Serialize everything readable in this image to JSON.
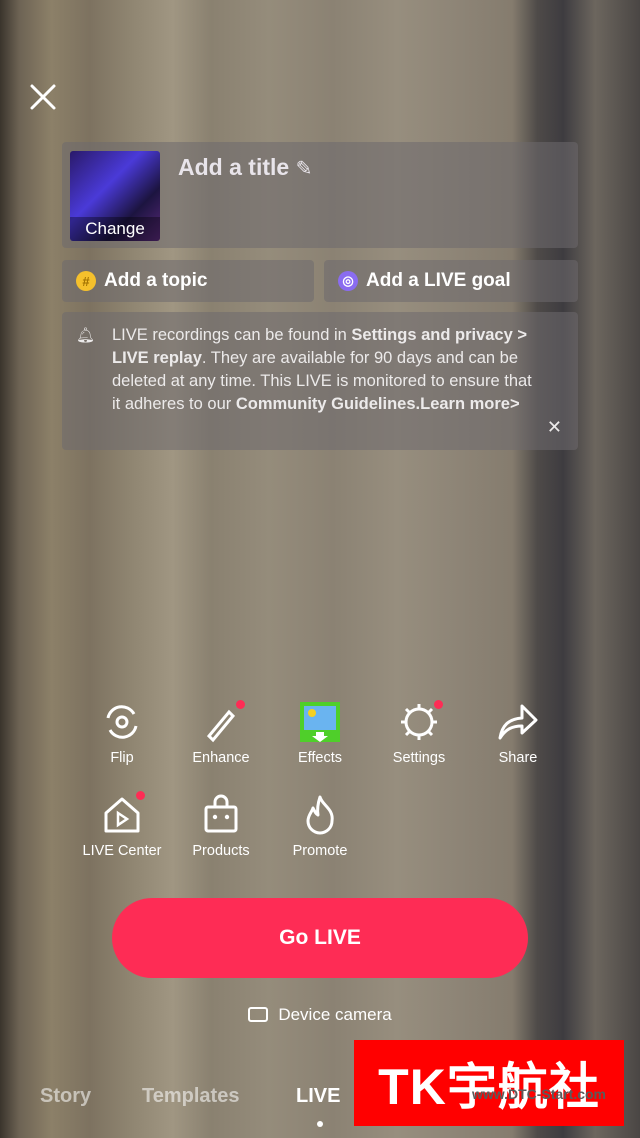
{
  "header": {
    "close_icon": "close-icon"
  },
  "title_card": {
    "thumbnail_change": "Change",
    "title_placeholder": "Add a title"
  },
  "options": {
    "topic": "Add a topic",
    "goal": "Add a LIVE goal"
  },
  "notice": {
    "t1": "LIVE recordings can be found in ",
    "b1": "Settings and privacy > LIVE replay",
    "t2": ". They are available for 90 days and can be deleted at any time. This LIVE is monitored to ensure that it adheres to our ",
    "b2": "Community Guidelines.",
    "link": "Learn more>"
  },
  "tools": [
    {
      "label": "Flip"
    },
    {
      "label": "Enhance",
      "badge": true
    },
    {
      "label": "Effects"
    },
    {
      "label": "Settings",
      "badge": true
    },
    {
      "label": "Share"
    },
    {
      "label": "LIVE Center",
      "badge": true
    },
    {
      "label": "Products"
    },
    {
      "label": "Promote"
    }
  ],
  "go_live": "Go LIVE",
  "camera": "Device camera",
  "mode_tabs": [
    {
      "label": "Story"
    },
    {
      "label": "Templates"
    },
    {
      "label": "LIVE",
      "active": true
    }
  ],
  "watermark": {
    "text": "TK宇航社",
    "url": "www.DTC-Start.com"
  },
  "colors": {
    "accent": "#fe2c55"
  }
}
